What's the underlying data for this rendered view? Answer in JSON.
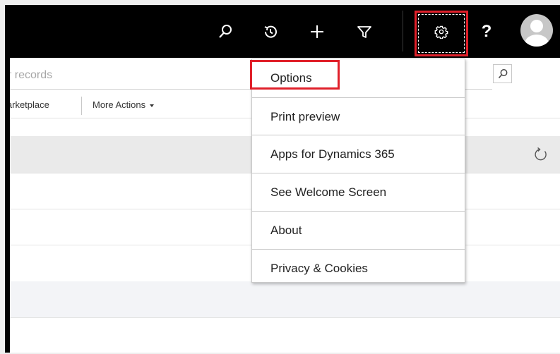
{
  "navbar": {
    "icons": [
      "search-icon",
      "recent-icon",
      "add-icon",
      "filter-icon",
      "gear-icon",
      "help-icon",
      "user-avatar-icon"
    ],
    "help_label": "?"
  },
  "search": {
    "placeholder": "r records"
  },
  "command_bar": {
    "marketplace_label": "larketplace",
    "more_actions_label": "More Actions"
  },
  "settings_menu": {
    "items": [
      {
        "label": "Options",
        "highlighted": true
      },
      {
        "label": "Print preview"
      },
      {
        "label": "Apps for Dynamics 365"
      },
      {
        "label": "See Welcome Screen"
      },
      {
        "label": "About"
      },
      {
        "label": "Privacy & Cookies"
      }
    ]
  },
  "colors": {
    "navbar_bg": "#000000",
    "highlight": "#e0202a",
    "grid_header": "#eaeaea"
  }
}
